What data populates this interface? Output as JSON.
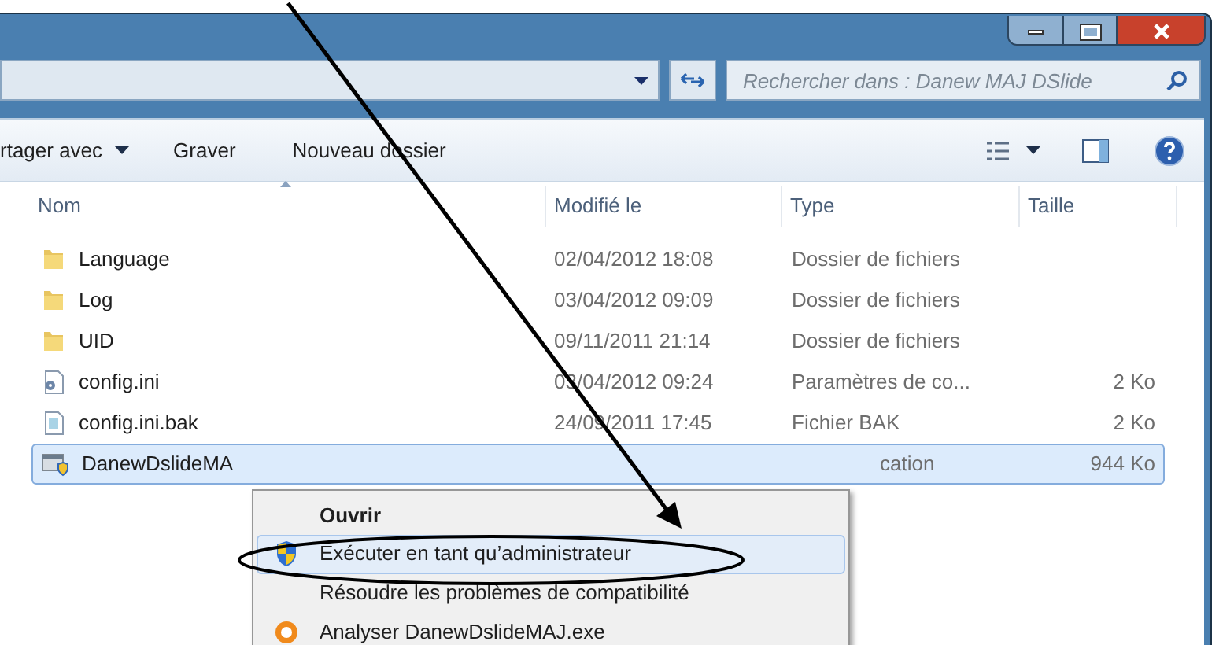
{
  "search": {
    "placeholder": "Rechercher dans : Danew MAJ DSlide"
  },
  "toolbar": [
    "rtager avec",
    "Graver",
    "Nouveau dossier"
  ],
  "columns": [
    "Nom",
    "Modifié le",
    "Type",
    "Taille"
  ],
  "rows": [
    {
      "kind": "folder",
      "name": "Language",
      "modified": "02/04/2012 18:08",
      "type": "Dossier de fichiers",
      "size": "",
      "selected": false
    },
    {
      "kind": "folder",
      "name": "Log",
      "modified": "03/04/2012 09:09",
      "type": "Dossier de fichiers",
      "size": "",
      "selected": false
    },
    {
      "kind": "folder",
      "name": "UID",
      "modified": "09/11/2011 21:14",
      "type": "Dossier de fichiers",
      "size": "",
      "selected": false
    },
    {
      "kind": "settings",
      "name": "config.ini",
      "modified": "03/04/2012 09:24",
      "type": "Paramètres de co...",
      "size": "2 Ko",
      "selected": false
    },
    {
      "kind": "file",
      "name": "config.ini.bak",
      "modified": "24/09/2011 17:45",
      "type": "Fichier BAK",
      "size": "2 Ko",
      "selected": false
    },
    {
      "kind": "app",
      "name": "DanewDslideMA",
      "modified": "",
      "type": "cation",
      "size": "944 Ko",
      "selected": true
    }
  ],
  "context_menu": [
    {
      "label": "Ouvrir",
      "kind": "default",
      "selected": false
    },
    {
      "label": "Exécuter en tant qu’administrateur",
      "kind": "shield",
      "selected": true
    },
    {
      "label": "Résoudre les problèmes de compatibilité",
      "kind": "plain",
      "selected": false
    },
    {
      "label": "Analyser DanewDslideMAJ.exe",
      "kind": "scan",
      "selected": false
    }
  ]
}
